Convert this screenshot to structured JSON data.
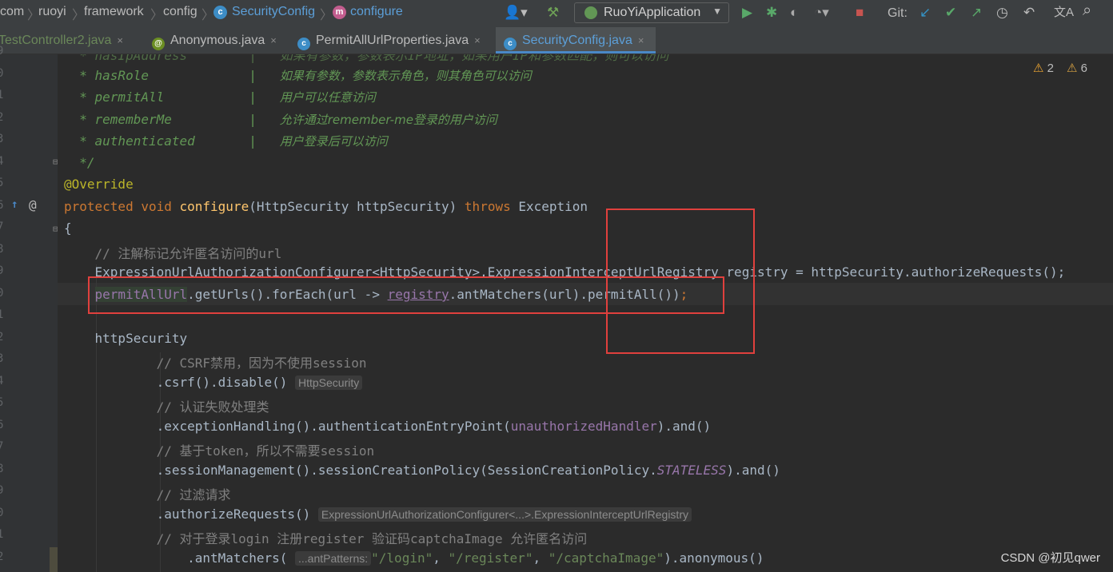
{
  "breadcrumbs": {
    "c1": "com",
    "c2": "ruoyi",
    "c3": "framework",
    "c4": "config",
    "c5": "SecurityConfig",
    "c6": "configure",
    "class_icon": "c",
    "method_icon": "m"
  },
  "toolbar": {
    "run_config": "RuoYiApplication",
    "git_label": "Git:",
    "icons": {
      "user": "👤▾",
      "build": "⚒",
      "run": "▶",
      "debug": "✱",
      "coverage": "◐",
      "profile": "◔▾",
      "stop": "■",
      "git_update": "↙",
      "git_commit": "✔",
      "git_push": "↗",
      "history": "◷",
      "rollback": "↶",
      "translate": "文A",
      "search": "⌕"
    }
  },
  "tabs": [
    {
      "label": "TestController2.java",
      "icon": "c",
      "close": "×"
    },
    {
      "label": "Anonymous.java",
      "icon": "@",
      "close": "×"
    },
    {
      "label": "PermitAllUrlProperties.java",
      "icon": "c",
      "close": "×"
    },
    {
      "label": "SecurityConfig.java",
      "icon": "c",
      "close": "×"
    }
  ],
  "gutter": {
    "line_numbers": [
      "9",
      "0",
      "1",
      "2",
      "3",
      "4",
      "5",
      "6",
      "7",
      "8",
      "9",
      "0",
      "1",
      "2",
      "3",
      "4",
      "5",
      "6",
      "7",
      "8",
      "9",
      "0",
      "1",
      "2"
    ],
    "override_marker": "↑",
    "at_marker": "@",
    "bulb": "💡"
  },
  "inspections": {
    "warnings": "2",
    "weak_warnings": "6",
    "warn_icon": "⚠"
  },
  "code": {
    "l0": "  * hasIpAddress        |   如果有参数，参数表示IP地址，如果用户IP和参数匹配，则可以访问",
    "l1a": "  * hasRole             |   ",
    "l1b": "如果有参数，参数表示角色，则其角色可以访问",
    "l2a": "  * permitAll           |   ",
    "l2b": "用户可以任意访问",
    "l3a": "  * rememberMe          |   ",
    "l3b": "允许通过remember-me登录的用户访问",
    "l4a": "  * authenticated       |   ",
    "l4b": "用户登录后可以访问",
    "l5": "  */",
    "l6": "@Override",
    "l7_kw1": "protected void ",
    "l7_m": "configure",
    "l7_a": "(HttpSecurity httpSecurity) ",
    "l7_kw2": "throws ",
    "l7_b": "Exception",
    "l8": "{",
    "l9": "    // 注解标记允许匿名访问的url",
    "l10a": "    ExpressionUrlAuthorizationConfigurer<HttpSecurity>.ExpressionInterceptUrlRegistry ",
    "l10b": "registry = httpSecurity.authorizeRequests();",
    "l11_indent": "    ",
    "l11_f": "permitAllUrl",
    "l11_a": ".getUrls().forEach(url -> ",
    "l11_reg": "registry",
    "l11_b": ".antMatchers(url).permitAll())",
    ";": ";",
    "l13": "    httpSecurity",
    "l14": "            // CSRF禁用，因为不使用session",
    "l15a": "            .csrf().disable() ",
    "l15h": "HttpSecurity",
    "l16": "            // 认证失败处理类",
    "l17a": "            .exceptionHandling().authenticationEntryPoint(",
    "l17f": "unauthorizedHandler",
    "l17b": ").and()",
    "l18": "            // 基于token，所以不需要session",
    "l19a": "            .sessionManagement().sessionCreationPolicy(SessionCreationPolicy.",
    "l19s": "STATELESS",
    "l19b": ").and()",
    "l20": "            // 过滤请求",
    "l21a": "            .authorizeRequests() ",
    "l21h": "ExpressionUrlAuthorizationConfigurer<...>.ExpressionInterceptUrlRegistry",
    "l22": "            // 对于登录login 注册register 验证码captchaImage 允许匿名访问",
    "l23a": "                .antMatchers( ",
    "l23h": "...antPatterns:",
    "l23s1": "\"/login\"",
    "l23c1": ", ",
    "l23s2": "\"/register\"",
    "l23c2": ", ",
    "l23s3": "\"/captchaImage\"",
    "l23b": ").anonymous()"
  },
  "watermark": "CSDN @初见qwer",
  "colors": {
    "bg": "#2b2b2b",
    "keyword": "#cc7832",
    "method": "#ffc66d",
    "field": "#9876aa",
    "string": "#6a8759",
    "doc": "#629755",
    "annotation": "#bbb529",
    "red_box": "#e0403d",
    "active_tab": "#5c9fd8"
  }
}
